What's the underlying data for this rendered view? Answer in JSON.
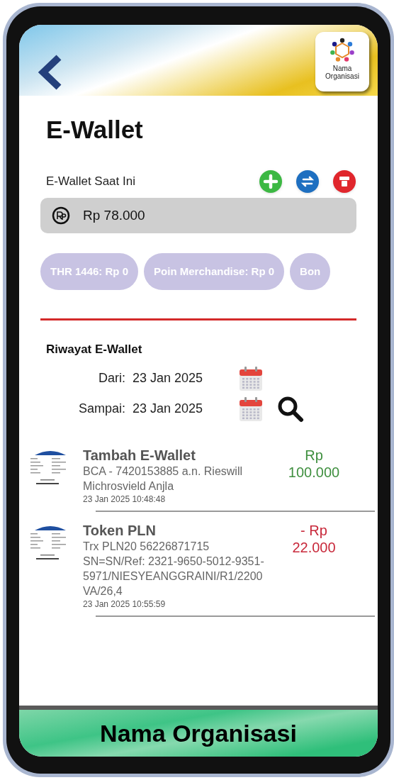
{
  "header": {
    "logo_label": "Nama Organisasi"
  },
  "title": "E-Wallet",
  "balance": {
    "label": "E-Wallet Saat Ini",
    "amount": "Rp 78.000",
    "actions": [
      {
        "kind": "add"
      },
      {
        "kind": "transfer"
      },
      {
        "kind": "token"
      }
    ]
  },
  "chips": [
    {
      "label": "THR 1446: Rp 0"
    },
    {
      "label": "Poin Merchandise: Rp 0"
    },
    {
      "label": "Bon"
    }
  ],
  "history": {
    "title": "Riwayat E-Wallet",
    "from": {
      "label": "Dari:",
      "value": "23 Jan 2025"
    },
    "to": {
      "label": "Sampai:",
      "value": "23 Jan 2025"
    }
  },
  "transactions": [
    {
      "kind": "credit",
      "title": "Tambah E-Wallet",
      "description": "BCA - 7420153885 a.n. Rieswill Michrosvield Anjla",
      "date": "23 Jan 2025 10:48:48",
      "currency": "Rp",
      "amount": "100.000"
    },
    {
      "kind": "debit",
      "title": "Token PLN",
      "description": "Trx PLN20 56226871715 SN=SN/Ref: 2321-9650-5012-9351-5971/NIESYEANGGRAINI/R1/2200VA/26,4",
      "date": "23 Jan 2025 10:55:59",
      "currency": "- Rp",
      "amount": "22.000"
    }
  ],
  "footer": {
    "label": "Nama Organisasi"
  }
}
